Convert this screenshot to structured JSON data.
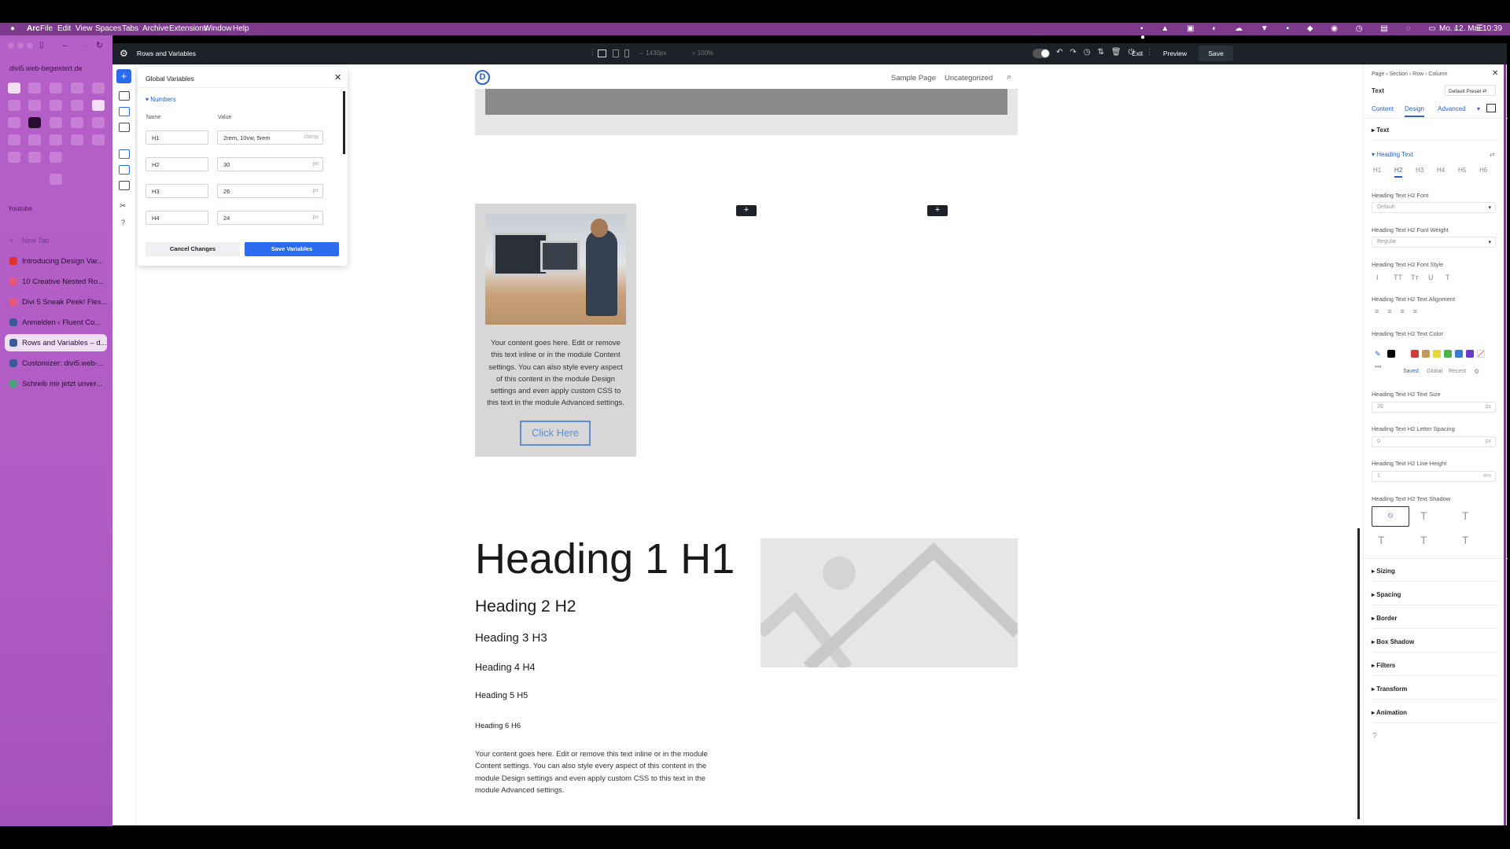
{
  "menubar": {
    "apple_icon": "apple-icon",
    "items": [
      "Arc",
      "File",
      "Edit",
      "View",
      "Spaces",
      "Tabs",
      "Archive",
      "Extensions",
      "Window",
      "Help"
    ],
    "datetime": "Mo. 12. Mai 10:39"
  },
  "arc": {
    "url": "divi5.web-begeistert.de",
    "section_label": "Youtube",
    "new_tab": "New Tab",
    "tabs": [
      {
        "label": "Introducing Design Var...",
        "color": "#e0342b"
      },
      {
        "label": "10 Creative Nested Ro...",
        "color": "#e8587a"
      },
      {
        "label": "Divi 5 Sneak Peek! Flex...",
        "color": "#e8587a"
      },
      {
        "label": "Anmelden ‹ Fluent Co...",
        "color": "#3a5a9a"
      },
      {
        "label": "Rows and Variables – d...",
        "color": "#3a5a9a",
        "active": true
      },
      {
        "label": "Customizer: divi5.web-...",
        "color": "#3a5a9a"
      },
      {
        "label": "Schreib mir jetzt unver...",
        "color": "#4aa37a"
      }
    ]
  },
  "topbar": {
    "title": "Rows and Variables",
    "width_value": "1430px",
    "zoom_value": "100%",
    "exit": "Exit",
    "preview": "Preview",
    "save": "Save"
  },
  "global_vars": {
    "title": "Global Variables",
    "group": "Numbers",
    "col_name": "Name",
    "col_value": "Value",
    "rows": [
      {
        "name": "H1",
        "value": "2rem, 10vw, 5rem",
        "unit": "clamp"
      },
      {
        "name": "H2",
        "value": "30",
        "unit": "px"
      },
      {
        "name": "H3",
        "value": "26",
        "unit": "px"
      },
      {
        "name": "H4",
        "value": "24",
        "unit": "px"
      }
    ],
    "cancel": "Cancel Changes",
    "save": "Save Variables"
  },
  "page": {
    "logo": "D",
    "nav": [
      "Sample Page",
      "Uncategorized"
    ],
    "card_text": "Your content goes here. Edit or remove this text inline or in the module Content settings. You can also style every aspect of this content in the module Design settings and even apply custom CSS to this text in the module Advanced settings.",
    "button": "Click Here",
    "h1": "Heading 1 H1",
    "h2": "Heading 2 H2",
    "h3": "Heading 3 H3",
    "h4": "Heading 4 H4",
    "h5": "Heading 5 H5",
    "h6": "Heading 6 H6",
    "body": "Your content goes here. Edit or remove this text inline or in the module Content settings. You can also style every aspect of this content in the module Design settings and even apply custom CSS to this text in the module Advanced settings."
  },
  "right_panel": {
    "breadcrumb": "Page › Section › Row › Column",
    "module": "Text",
    "preset": "Default Preset",
    "tabs": [
      "Content",
      "Design",
      "Advanced"
    ],
    "text_section": "Text",
    "heading_section": "Heading Text",
    "heading_tabs": [
      "H1",
      "H2",
      "H3",
      "H4",
      "H5",
      "H6"
    ],
    "font_label": "Heading Text H2 Font",
    "font_value": "Default",
    "weight_label": "Heading Text H2 Font Weight",
    "weight_value": "Regular",
    "style_label": "Heading Text H2 Font Style",
    "style_buttons": [
      "I",
      "TT",
      "Tт",
      "U",
      "T"
    ],
    "align_label": "Heading Text H2 Text Alignment",
    "color_label": "Heading Text H2 Text Color",
    "swatches": [
      "#000000",
      "#d23b3b",
      "#c89a5a",
      "#e8d83a",
      "#4ab44a",
      "#3a7ad2",
      "#6a3ac8"
    ],
    "color_tabs": [
      "Saved",
      "Global",
      "Recent"
    ],
    "size_label": "Heading Text H2 Text Size",
    "size_value": "26",
    "size_unit": "px",
    "spacing_label": "Heading Text H2 Letter Spacing",
    "spacing_value": "0",
    "spacing_unit": "px",
    "lh_label": "Heading Text H2 Line Height",
    "lh_value": "1",
    "lh_unit": "em",
    "shadow_label": "Heading Text H2 Text Shadow",
    "sections": [
      "Sizing",
      "Spacing",
      "Border",
      "Box Shadow",
      "Filters",
      "Transform",
      "Animation"
    ]
  }
}
